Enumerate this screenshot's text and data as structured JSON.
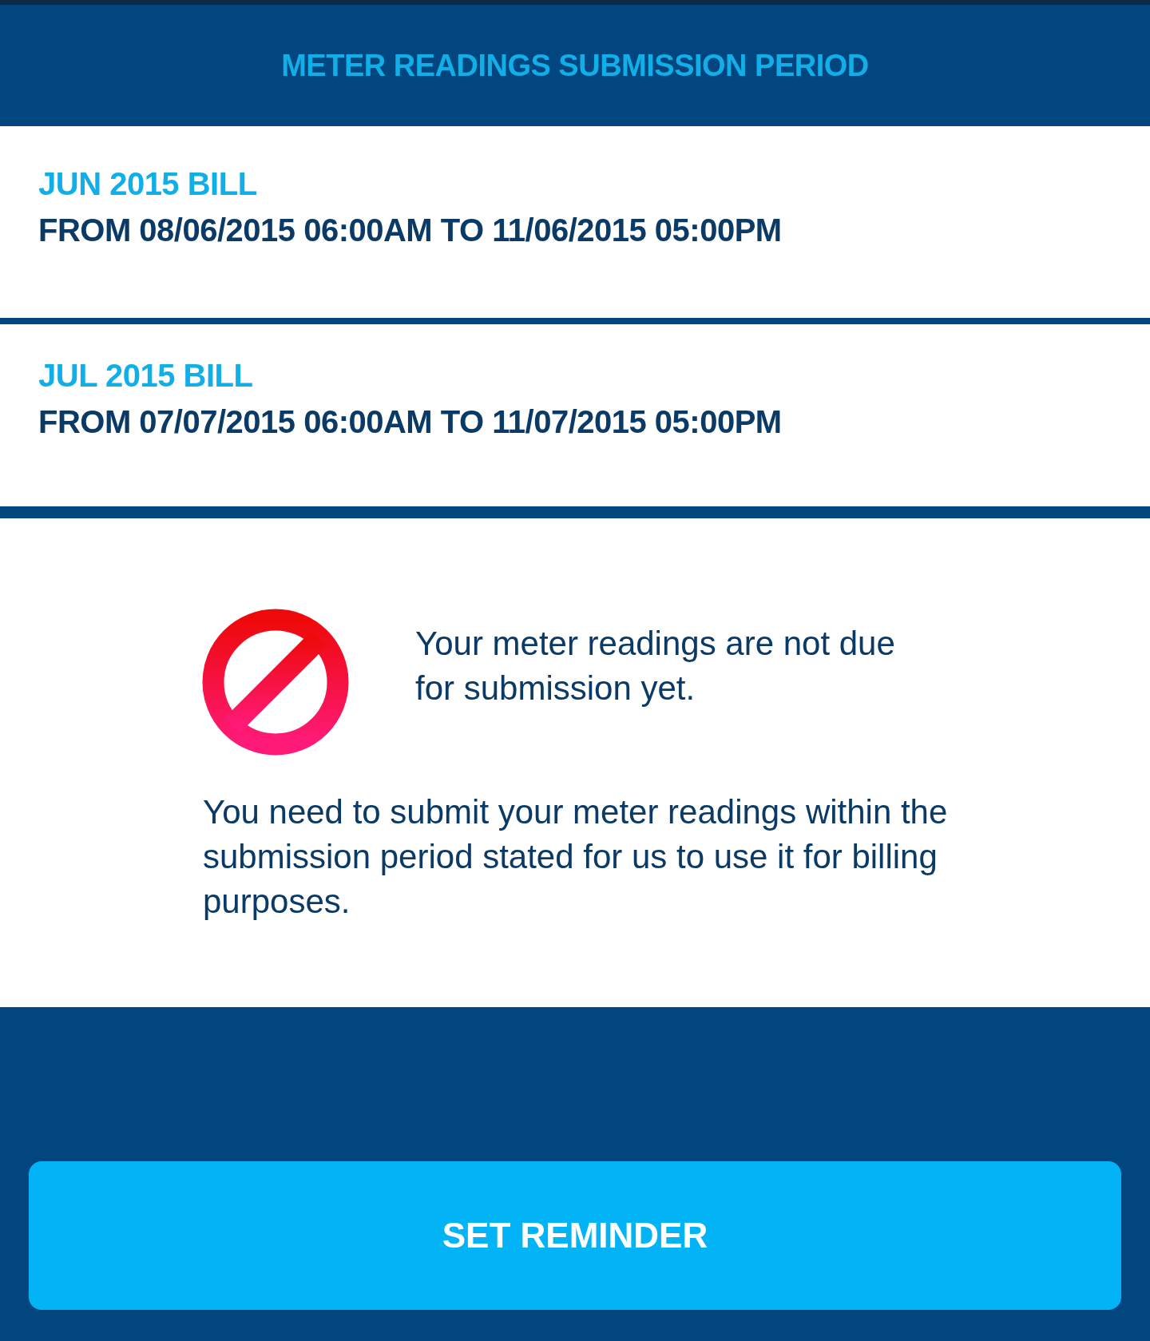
{
  "header": {
    "title": "METER READINGS SUBMISSION PERIOD"
  },
  "bills": [
    {
      "label": "JUN 2015 BILL",
      "period": "FROM 08/06/2015 06:00AM TO 11/06/2015 05:00PM"
    },
    {
      "label": "JUL 2015 BILL",
      "period": "FROM 07/07/2015 06:00AM TO 11/07/2015 05:00PM"
    }
  ],
  "notice": {
    "status": "Your meter readings are not due for submission yet.",
    "explanation": "You need to submit your meter readings within the submission period stated for us to use it for billing purposes."
  },
  "button": {
    "label": "SET REMINDER"
  }
}
